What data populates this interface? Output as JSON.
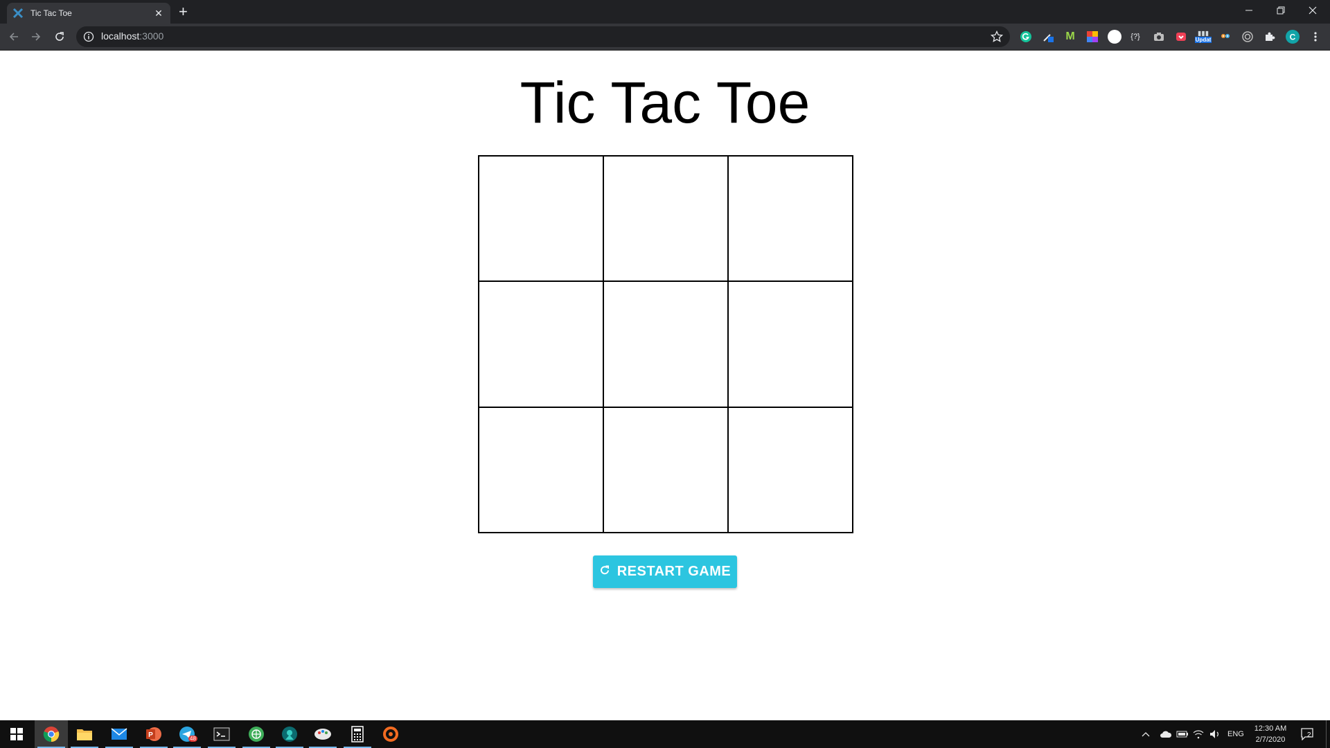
{
  "browser": {
    "tab_title": "Tic Tac Toe",
    "url_host": "localhost",
    "url_port": ":3000",
    "ext_update_badge": "Updat"
  },
  "page": {
    "title": "Tic Tac Toe",
    "board": [
      "",
      "",
      "",
      "",
      "",
      "",
      "",
      "",
      ""
    ],
    "restart_label": "RESTART GAME",
    "accent": "#2cc5e0"
  },
  "taskbar": {
    "telegram_badge": "48",
    "language": "ENG",
    "time": "12:30 AM",
    "date": "2/7/2020",
    "notifications": "2"
  }
}
